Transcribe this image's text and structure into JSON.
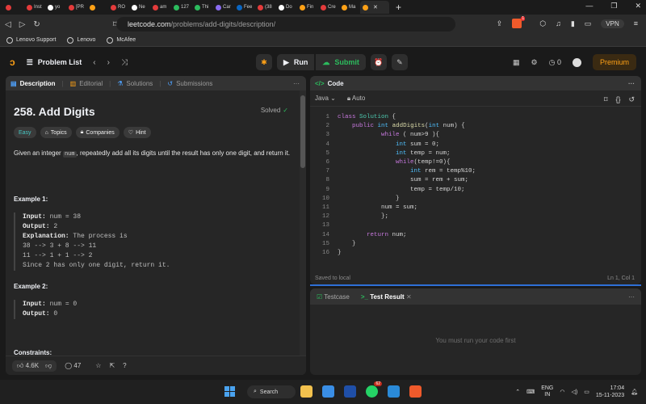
{
  "browser": {
    "tabs": [
      {
        "label": "",
        "color": "#e33b3b"
      },
      {
        "label": "Inst",
        "color": "#e33b3b"
      },
      {
        "label": "yo",
        "color": "#ffffff"
      },
      {
        "label": "[PR",
        "color": "#e33b3b"
      },
      {
        "label": "",
        "color": "#ffa116"
      },
      {
        "label": "RO",
        "color": "#e33b3b"
      },
      {
        "label": "Ne",
        "color": "#ffffff"
      },
      {
        "label": "am",
        "color": "#e33b3b"
      },
      {
        "label": "127",
        "color": "#2cbb5d"
      },
      {
        "label": "Thi",
        "color": "#2cbb5d"
      },
      {
        "label": "Car",
        "color": "#8a6cf0"
      },
      {
        "label": "Fee",
        "color": "#0a66c2"
      },
      {
        "label": "(38",
        "color": "#e33b3b"
      },
      {
        "label": "Do",
        "color": "#ffffff"
      },
      {
        "label": "Fin",
        "color": "#ffa116"
      },
      {
        "label": "Cre",
        "color": "#e33b3b"
      },
      {
        "label": "Ma",
        "color": "#ffa116"
      },
      {
        "label": "",
        "color": "#ffa116",
        "active": true
      }
    ],
    "url_host": "leetcode.com",
    "url_path": "/problems/add-digits/description/",
    "brave_badge": "1",
    "vpn_label": "VPN",
    "bookmarks": [
      "Lenovo Support",
      "Lenovo",
      "McAfee"
    ]
  },
  "nav": {
    "problem_list": "Problem List",
    "run": "Run",
    "submit": "Submit",
    "streak": "0",
    "premium": "Premium"
  },
  "left": {
    "tabs": [
      "Description",
      "Editorial",
      "Solutions",
      "Submissions"
    ],
    "title": "258. Add Digits",
    "solved": "Solved",
    "tags": [
      "Easy",
      "Topics",
      "Companies",
      "Hint"
    ],
    "desc_pre": "Given an integer ",
    "desc_code": "num",
    "desc_post": ", repeatedly add all its digits until the result has only one digit, and return it.",
    "ex1_title": "Example 1:",
    "ex1": {
      "input_label": "Input:",
      "input": "num = 38",
      "output_label": "Output:",
      "output": "2",
      "expl_label": "Explanation:",
      "expl": "The process is",
      "lines": [
        "38 --> 3 + 8 --> 11",
        "11 --> 1 + 1 --> 2",
        "Since 2 has only one digit, return it."
      ]
    },
    "ex2_title": "Example 2:",
    "ex2": {
      "input_label": "Input:",
      "input": "num = 0",
      "output_label": "Output:",
      "output": "0"
    },
    "constraints": "Constraints:",
    "likes": "4.6K",
    "comments": "47"
  },
  "code": {
    "header": "Code",
    "language": "Java",
    "mode": "Auto",
    "saved": "Saved to local",
    "cursor": "Ln 1, Col 1",
    "lines": [
      "class Solution {",
      "    public int addDigits(int num) {",
      "            while ( num>9 ){",
      "                int sum = 0;",
      "                int temp = num;",
      "                while(temp!=0){",
      "                    int rem = temp%10;",
      "                    sum = rem + sum;",
      "                    temp = temp/10;",
      "                }",
      "            num = sum;",
      "            };",
      "",
      "        return num;",
      "    }",
      "}"
    ]
  },
  "console": {
    "tab_testcase": "Testcase",
    "tab_result": "Test Result",
    "empty": "You must run your code first"
  },
  "taskbar": {
    "search": "Search",
    "whatsapp_badge": "62",
    "lang_top": "ENG",
    "lang_bottom": "IN",
    "time": "17:04",
    "date": "15-11-2023"
  }
}
